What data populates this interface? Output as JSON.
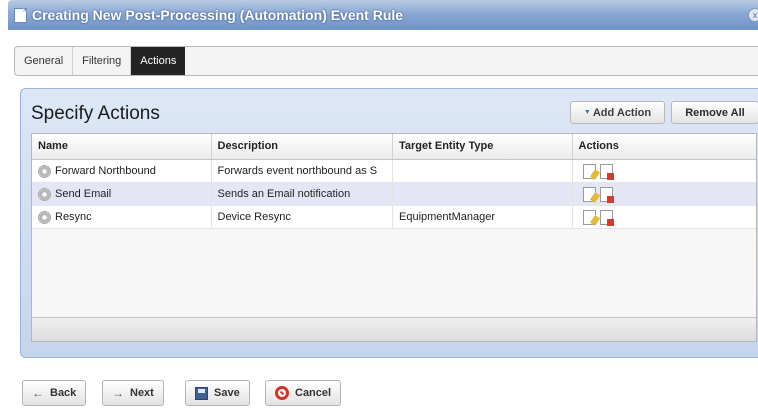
{
  "window": {
    "title": "Creating New Post-Processing (Automation) Event Rule",
    "close_glyph": "x"
  },
  "tabs": [
    {
      "label": "General",
      "active": false
    },
    {
      "label": "Filtering",
      "active": false
    },
    {
      "label": "Actions",
      "active": true
    }
  ],
  "panel": {
    "title": "Specify Actions",
    "add_action_label": "Add Action",
    "remove_all_label": "Remove All"
  },
  "grid": {
    "columns": [
      "Name",
      "Description",
      "Target Entity Type",
      "Actions"
    ],
    "rows": [
      {
        "name": "Forward Northbound",
        "description": "Forwards event northbound as S",
        "target": "",
        "icon": "gear-icon"
      },
      {
        "name": "Send Email",
        "description": "Sends an Email notification",
        "target": "",
        "icon": "gear-icon"
      },
      {
        "name": "Resync",
        "description": "Device Resync",
        "target": "EquipmentManager",
        "icon": "gear-icon"
      }
    ]
  },
  "buttons": {
    "back": "Back",
    "next": "Next",
    "save": "Save",
    "cancel": "Cancel"
  },
  "colors": {
    "titlebar": "#6f93c6",
    "panel": "#c4d5ee",
    "active_tab": "#242424",
    "selected_row": "#e4e6f6"
  }
}
